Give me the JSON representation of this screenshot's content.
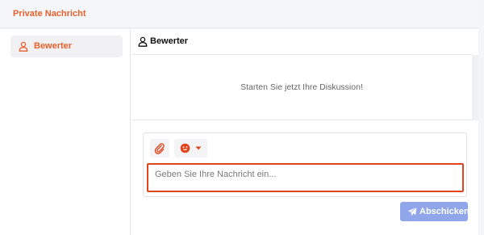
{
  "colors": {
    "accent": "#e8602c",
    "input_highlight": "#e2451b",
    "send_button": "#8fa7ea"
  },
  "header": {
    "title": "Private Nachricht"
  },
  "sidebar": {
    "items": [
      {
        "icon": "user-icon",
        "label": "Bewerter"
      }
    ]
  },
  "chat": {
    "header": {
      "icon": "user-icon",
      "title": "Bewerter"
    },
    "empty_message": "Starten Sie jetzt Ihre Diskussion!",
    "composer": {
      "tools": [
        {
          "icon": "paperclip-icon"
        },
        {
          "icon": "emoji-icon",
          "dropdown_icon": "caret-down-icon"
        }
      ],
      "input": {
        "value": "",
        "placeholder": "Geben Sie Ihre Nachricht ein..."
      },
      "send_button": {
        "icon": "send-icon",
        "label": "Abschicken"
      }
    }
  }
}
